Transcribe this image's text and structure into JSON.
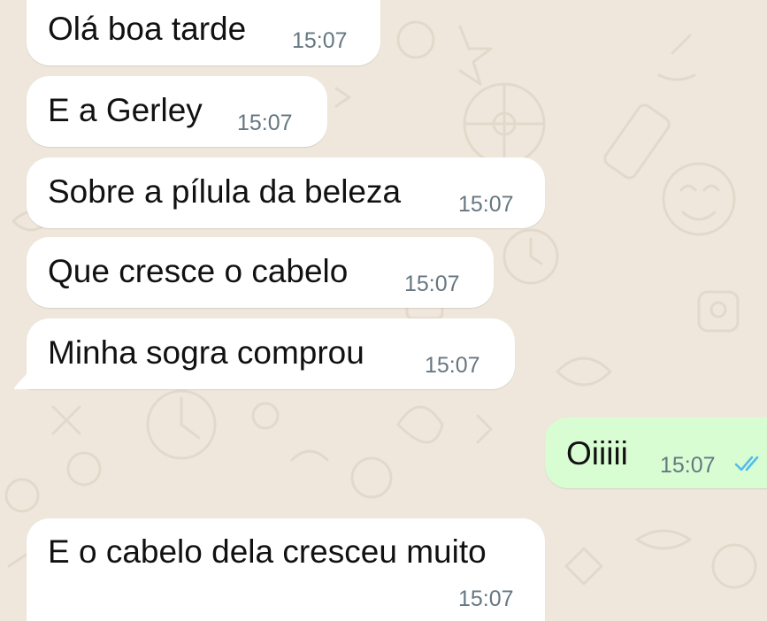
{
  "chat": {
    "colors": {
      "background": "#efe7dc",
      "incoming_bubble": "#ffffff",
      "outgoing_bubble": "#d9fdd3",
      "timestamp": "#667781",
      "read_check": "#53bdeb"
    },
    "messages": [
      {
        "direction": "incoming",
        "text": "Olá boa tarde",
        "time": "15:07"
      },
      {
        "direction": "incoming",
        "text": "E a Gerley",
        "time": "15:07"
      },
      {
        "direction": "incoming",
        "text": "Sobre a pílula da beleza",
        "time": "15:07"
      },
      {
        "direction": "incoming",
        "text": "Que cresce o cabelo",
        "time": "15:07"
      },
      {
        "direction": "incoming",
        "text": "Minha sogra comprou",
        "time": "15:07"
      },
      {
        "direction": "outgoing",
        "text": "Oiiiii",
        "time": "15:07",
        "status_icon": "double-check-read-icon"
      },
      {
        "direction": "incoming",
        "text": "E o cabelo dela cresceu muito",
        "time": "15:07"
      }
    ]
  }
}
